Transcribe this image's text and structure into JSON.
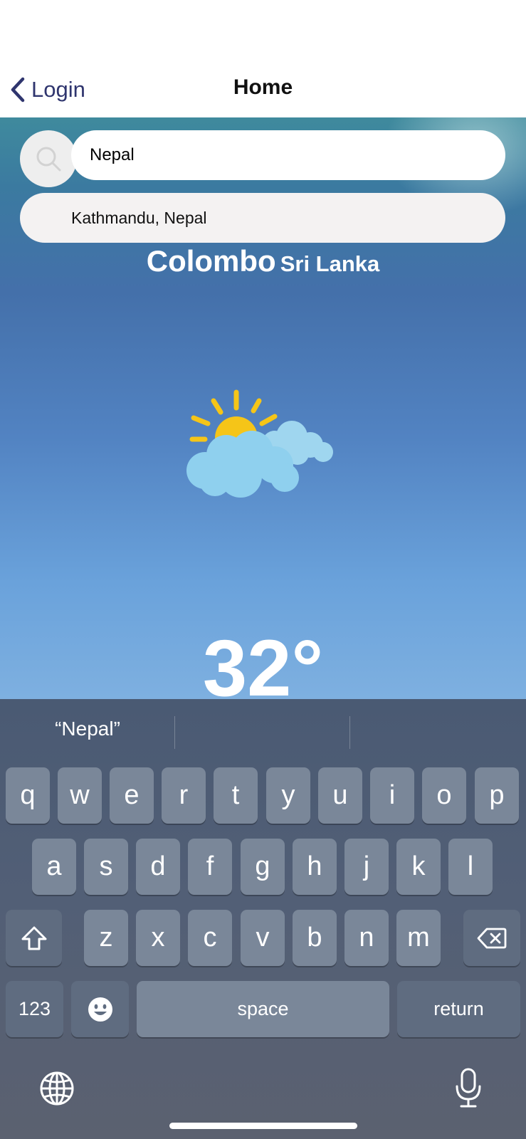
{
  "nav": {
    "back_label": "Login",
    "title": "Home"
  },
  "search": {
    "value": "Nepal",
    "suggestions": [
      "Kathmandu, Nepal"
    ]
  },
  "weather": {
    "city": "Colombo",
    "country": "Sri Lanka",
    "temperature": "32°",
    "icon": "partly-cloudy-icon"
  },
  "keyboard": {
    "prediction": "“Nepal”",
    "row1": [
      "q",
      "w",
      "e",
      "r",
      "t",
      "y",
      "u",
      "i",
      "o",
      "p"
    ],
    "row2": [
      "a",
      "s",
      "d",
      "f",
      "g",
      "h",
      "j",
      "k",
      "l"
    ],
    "row3": [
      "z",
      "x",
      "c",
      "v",
      "b",
      "n",
      "m"
    ],
    "numbers_label": "123",
    "space_label": "space",
    "return_label": "return"
  },
  "colors": {
    "nav_accent": "#2f356e",
    "caret": "#3a66e0",
    "sun": "#f5c518",
    "cloud": "#8fd0ee"
  }
}
